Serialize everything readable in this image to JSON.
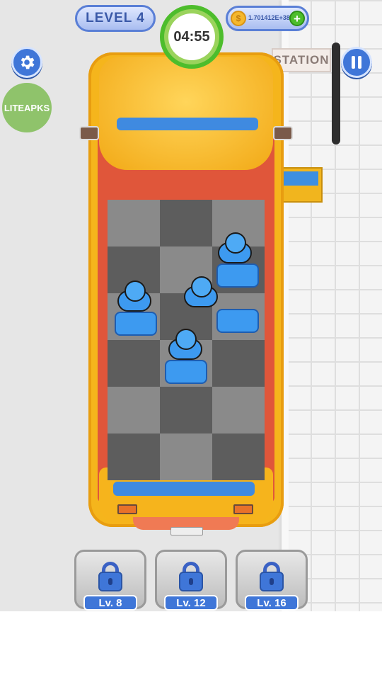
{
  "hud": {
    "level_label": "LEVEL 4",
    "timer": "04:55",
    "coins": "1.701412E+38",
    "lite_label": "LITEAPKS",
    "station_label": "STATION"
  },
  "slots": [
    {
      "label": "Lv. 8"
    },
    {
      "label": "Lv. 12"
    },
    {
      "label": "Lv. 16"
    }
  ],
  "colors": {
    "accent_blue": "#3f76d8",
    "timer_green": "#4dbd2c",
    "bus_yellow": "#f5b51c",
    "passenger_blue": "#3d9af0"
  },
  "icons": [
    "gear-icon",
    "pause-icon",
    "coin-icon",
    "plus-icon",
    "lock-icon"
  ]
}
